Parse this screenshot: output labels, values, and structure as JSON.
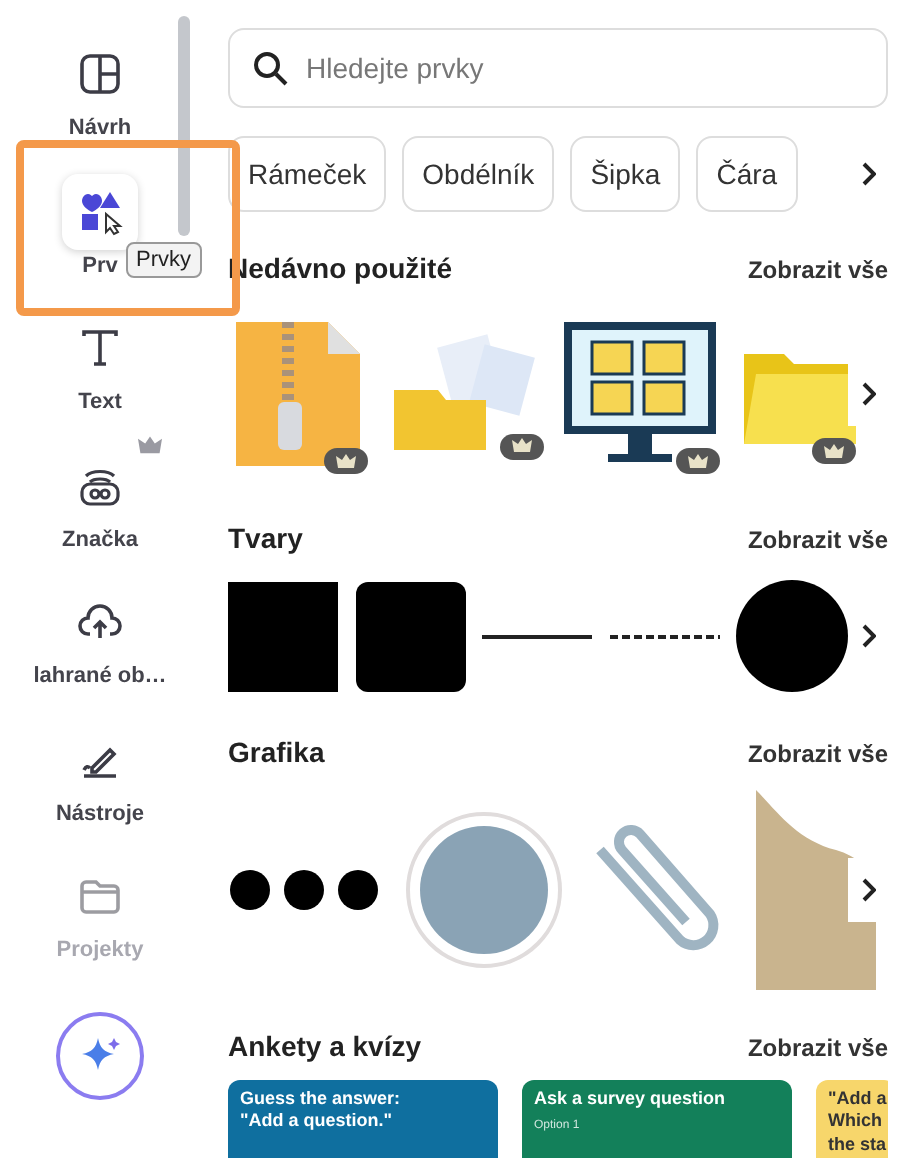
{
  "sidebar": {
    "items": [
      {
        "label": "Návrh",
        "kind": "layout",
        "selected": false,
        "disabled": false
      },
      {
        "label": "Prv",
        "kind": "elements",
        "selected": true,
        "disabled": false,
        "tooltip": "Prvky"
      },
      {
        "label": "Text",
        "kind": "text",
        "selected": false,
        "disabled": false
      },
      {
        "label": "Značka",
        "kind": "brand",
        "selected": false,
        "disabled": false,
        "premium": true
      },
      {
        "label": "lahrané ob…",
        "kind": "upload",
        "selected": false,
        "disabled": false
      },
      {
        "label": "Nástroje",
        "kind": "tools",
        "selected": false,
        "disabled": false
      },
      {
        "label": "Projekty",
        "kind": "folder",
        "selected": false,
        "disabled": true
      }
    ]
  },
  "search": {
    "placeholder": "Hledejte prvky"
  },
  "chips": [
    "Rámeček",
    "Obdélník",
    "Šipka",
    "Čára"
  ],
  "sections": [
    {
      "title": "Nedávno použité",
      "link": "Zobrazit vše",
      "kind": "recent",
      "items": [
        {
          "kind": "zip",
          "premium": true
        },
        {
          "kind": "papers",
          "premium": true
        },
        {
          "kind": "monitor",
          "premium": true
        },
        {
          "kind": "folder",
          "premium": true
        }
      ]
    },
    {
      "title": "Tvary",
      "link": "Zobrazit vše",
      "kind": "shapes",
      "items": [
        {
          "kind": "square"
        },
        {
          "kind": "rounded"
        },
        {
          "kind": "line"
        },
        {
          "kind": "dashed"
        },
        {
          "kind": "circle"
        }
      ]
    },
    {
      "title": "Grafika",
      "link": "Zobrazit vše",
      "kind": "graphics",
      "items": [
        {
          "kind": "dots"
        },
        {
          "kind": "ring"
        },
        {
          "kind": "clip"
        },
        {
          "kind": "paper"
        }
      ]
    },
    {
      "title": "Ankety a kvízy",
      "link": "Zobrazit vše",
      "kind": "quizzes",
      "cards": [
        {
          "color": "#0f6f9f",
          "lines": [
            "Guess the answer:",
            "\"Add a question.\""
          ]
        },
        {
          "color": "#13805a",
          "lines": [
            "Ask a survey question"
          ],
          "option": "Option 1"
        },
        {
          "color": "#f7d66b",
          "lines": [
            "\"Add a",
            "Which",
            "the sta"
          ]
        }
      ]
    }
  ]
}
